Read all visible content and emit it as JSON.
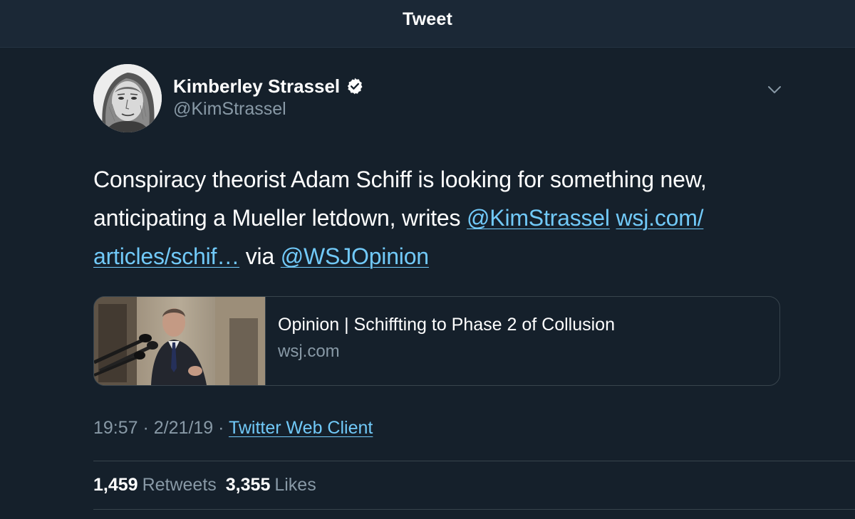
{
  "header": {
    "title": "Tweet"
  },
  "tweet": {
    "author": {
      "name": "Kimberley Strassel",
      "handle": "@KimStrassel",
      "verified": true,
      "avatar_icon": "avatar-portrait"
    },
    "menu_icon": "chevron-down-icon",
    "text": {
      "part1": "Conspiracy theorist Adam Schiff is looking for something new, anticipating a Mueller letdown, writes ",
      "mention1": "@KimStrassel",
      "space1": " ",
      "link": "wsj.com/​articles/schif…",
      "part2": " via ",
      "mention2": "@WSJOpinion"
    },
    "card": {
      "title": "Opinion | Schiffting to Phase 2 of Collusion",
      "domain": "wsj.com"
    },
    "meta": {
      "time": "19:57",
      "separator1": " · ",
      "date": "2/21/19",
      "separator2": " · ",
      "client": "Twitter Web Client"
    },
    "stats": {
      "retweets_count": "1,459",
      "retweets_label": "Retweets",
      "likes_count": "3,355",
      "likes_label": "Likes"
    }
  },
  "colors": {
    "background": "#15202b",
    "header_background": "#1b2836",
    "link": "#71c9f8",
    "secondary_text": "#8899a6",
    "border": "#38444d"
  }
}
